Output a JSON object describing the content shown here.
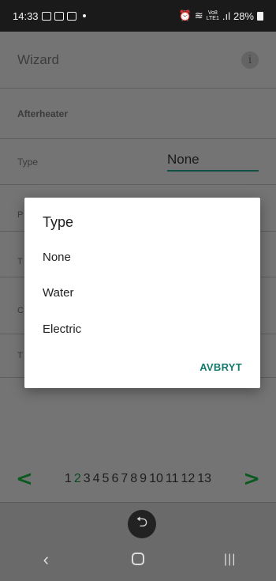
{
  "status_bar": {
    "time": "14:33",
    "net_top": "Vo8",
    "net_bottom": "LTE1",
    "signal": ".ıl",
    "battery": "28%"
  },
  "app": {
    "title": "Wizard",
    "info_icon": "i",
    "section": "Afterheater",
    "type_label": "Type",
    "type_value": "None",
    "partial_p": "P",
    "partial_t1": "T",
    "partial_c": "C",
    "partial_t2": "T"
  },
  "pager": {
    "prev": "<",
    "next": ">",
    "pages": [
      "1",
      "2",
      "3",
      "4",
      "5",
      "6",
      "7",
      "8",
      "9",
      "10",
      "11",
      "12",
      "13"
    ],
    "current_page": "2"
  },
  "dialog": {
    "title": "Type",
    "options": [
      "None",
      "Water",
      "Electric"
    ],
    "cancel": "AVBRYT"
  },
  "nav": {
    "back": "‹",
    "recents": "|||"
  },
  "fab": {
    "icon": "undo-icon",
    "glyph": "⮌"
  }
}
